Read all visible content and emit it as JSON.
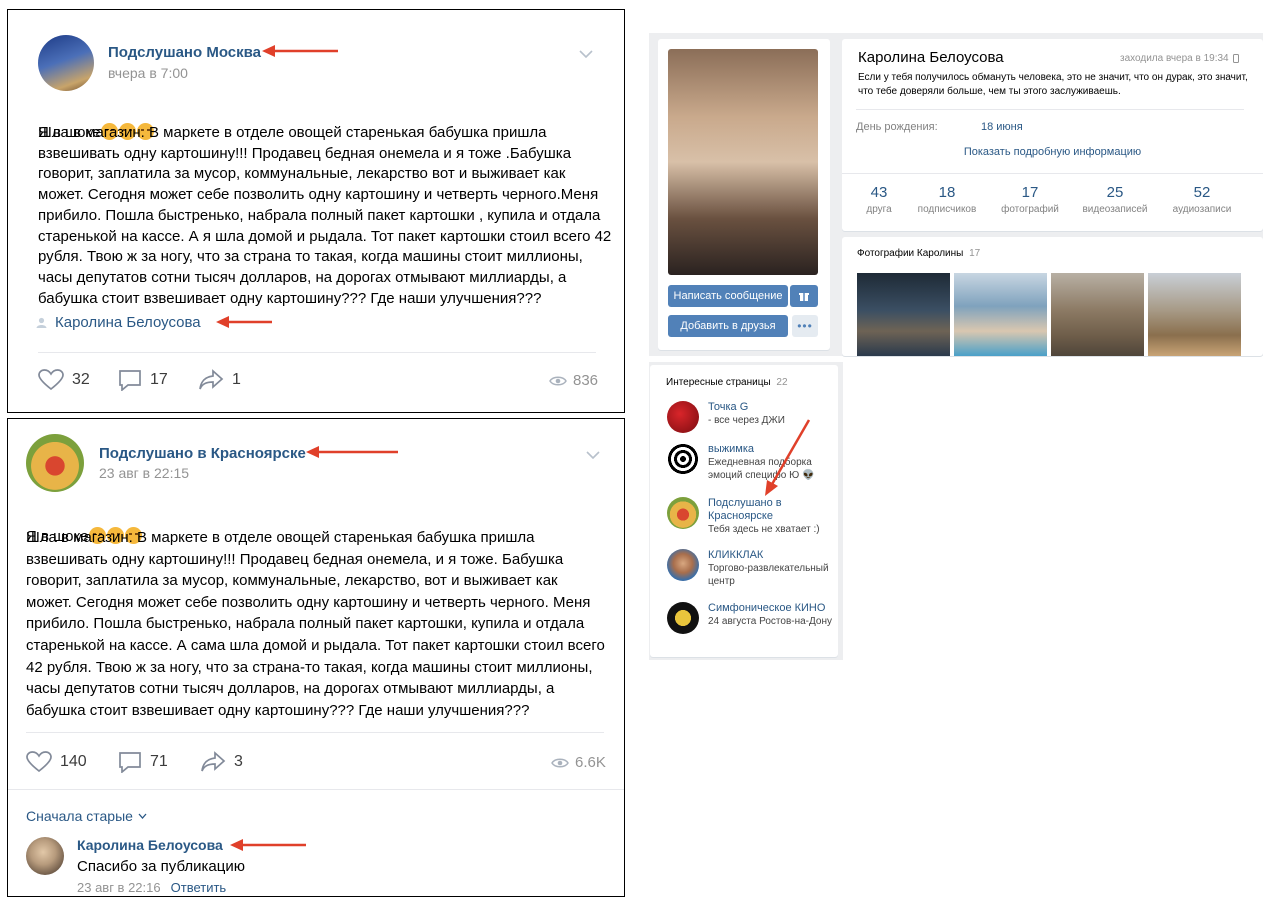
{
  "post1": {
    "group_name": "Подслушано Москва",
    "time": "вчера в 7:00",
    "text": "Шла в магазин. В маркете в отделе овощей старенькая бабушка пришла\nвзвешивать одну картошину!!! Продавец бедная онемела и я тоже .Бабушка\nговорит, заплатила за мусор, коммунальные, лекарство вот и выживает как\nможет. Сегодня может себе позволить одну картошину и четверть черного.Меня\nприбило. Пошла быстренько, набрала полный пакет картошки , купила и отдала\nстаренькой на кассе. А я шла домой и рыдала. Тот пакет картошки стоил всего 42\nрубля. Твою ж за ногу, что за страна то такая, когда машины стоит миллионы,\nчасы депутатов сотни тысяч долларов, на дорогах отмывают миллиарды, а\nбабушка стоит взвешивает одну картошину??? Где наши улучшения???",
    "first_line": "Я в шоке",
    "author": "Каролина Белоусова",
    "likes": "32",
    "comments": "17",
    "shares": "1",
    "views": "836"
  },
  "post2": {
    "group_name": "Подслушано в Красноярске",
    "time": "23 авг в 22:15",
    "first_line": "Я в шоке",
    "text": "Шла в магазин. В маркете в отделе овощей старенькая бабушка пришла\nвзвешивать одну картошину!!! Продавец бедная онемела, и я тоже. Бабушка\nговорит, заплатила за мусор, коммунальные, лекарство, вот и выживает как\nможет. Сегодня может себе позволить одну картошину и четверть черного. Меня\nприбило. Пошла быстренько, набрала полный пакет картошки, купила и отдала\nстаренькой на кассе. А сама шла домой и рыдала. Тот пакет картошки стоил всего\n42 рубля. Твою ж за ногу, что за страна-то такая, когда машины стоит миллионы,\nчасы депутатов сотни тысяч долларов, на дорогах отмывают миллиарды, а\nбабушка стоит взвешивает одну картошину??? Где наши улучшения???",
    "likes": "140",
    "comments": "71",
    "shares": "3",
    "views": "6.6K",
    "sort_label": "Сначала старые",
    "comment": {
      "author": "Каролина Белоусова",
      "text": "Спасибо за публикацию",
      "time": "23 авг в 22:16",
      "reply": "Ответить"
    }
  },
  "profile": {
    "name": "Каролина Белоусова",
    "last_seen": "заходила вчера в 19:34",
    "status": "Если у тебя получилось обмануть человека, это не значит, что он дурак, это значит, что тебе доверяли больше, чем ты этого заслуживаешь.",
    "birthday_label": "День рождения:",
    "birthday_value": "18 июня",
    "more_info": "Показать подробную информацию",
    "stats": [
      {
        "n": "43",
        "l": "друга"
      },
      {
        "n": "18",
        "l": "подписчиков"
      },
      {
        "n": "17",
        "l": "фотографий"
      },
      {
        "n": "25",
        "l": "видеозаписей"
      },
      {
        "n": "52",
        "l": "аудиозаписи"
      }
    ],
    "write_message": "Написать сообщение",
    "add_friend": "Добавить в друзья",
    "photos_title": "Фотографии Каролины",
    "photos_count": "17"
  },
  "interesting": {
    "title": "Интересные страницы",
    "count": "22",
    "items": [
      {
        "name": "Точка G",
        "desc": "- все через ДЖИ"
      },
      {
        "name": "выжимка",
        "desc": "Ежедневная подборка эмоций специфо Ю 👽"
      },
      {
        "name": "Подслушано в Красноярске",
        "desc": "Тебя здесь не хватает :)"
      },
      {
        "name": "КЛИККЛАК",
        "desc": "Торгово-развлекательный центр"
      },
      {
        "name": "Симфоническое КИНО",
        "desc": "24 августа Ростов-на-Дону"
      }
    ]
  },
  "colors": {
    "link": "#2a5885",
    "accent_arrow": "#e0402a",
    "vk_button": "#5181b8"
  }
}
